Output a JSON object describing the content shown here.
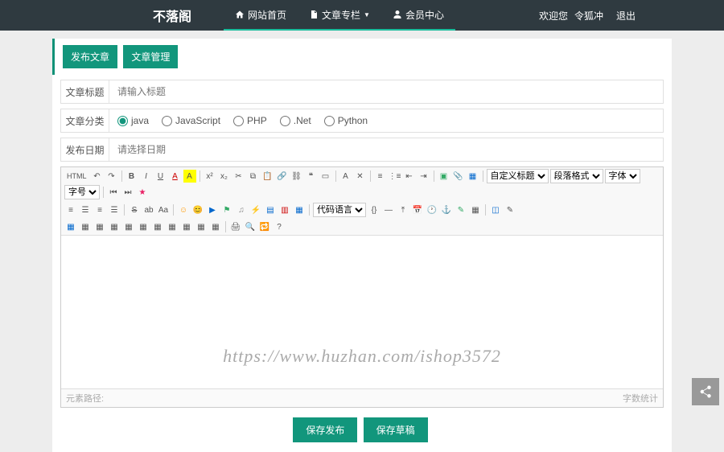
{
  "brand": "不落阁",
  "nav": {
    "home": "网站首页",
    "column": "文章专栏",
    "member": "会员中心"
  },
  "welcome": {
    "prefix": "欢迎您",
    "user": "令狐冲",
    "logout": "退出"
  },
  "tabs": {
    "publish": "发布文章",
    "manage": "文章管理"
  },
  "labels": {
    "title": "文章标题",
    "category": "文章分类",
    "date": "发布日期"
  },
  "placeholders": {
    "title": "请输入标题",
    "date": "请选择日期"
  },
  "categories": [
    "java",
    "JavaScript",
    "PHP",
    ".Net",
    "Python"
  ],
  "selects": {
    "custom": "自定义标题",
    "para": "段落格式",
    "font": "字体",
    "size": "字号",
    "lang": "代码语言"
  },
  "footer": {
    "path": "元素路径:",
    "count": "字数统计"
  },
  "actions": {
    "save": "保存发布",
    "draft": "保存草稿"
  },
  "watermark": "https://www.huzhan.com/ishop3572"
}
